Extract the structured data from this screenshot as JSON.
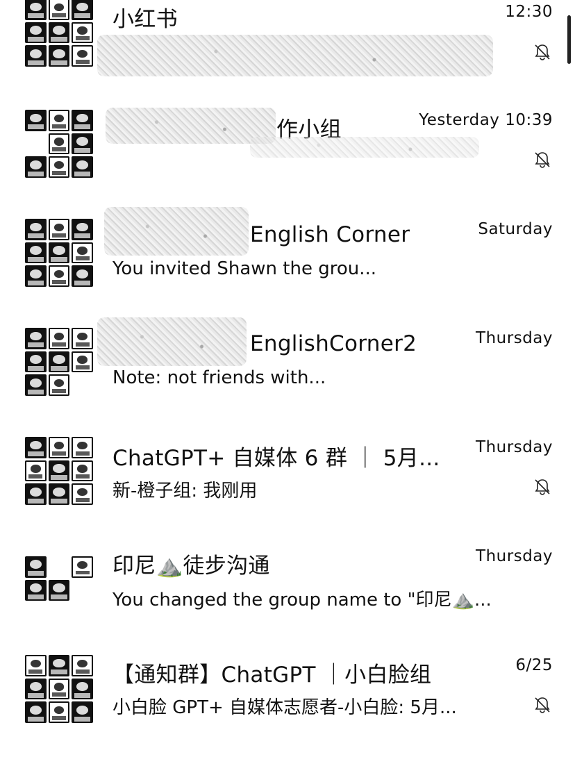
{
  "chats": [
    {
      "title": "小红书",
      "preview": "",
      "time": "12:30",
      "muted": true
    },
    {
      "title": "作小组",
      "preview": "",
      "time": "Yesterday 10:39",
      "muted": true
    },
    {
      "title": "English Corner",
      "preview": "You invited Shawn                  the grou...",
      "time": "Saturday",
      "muted": false
    },
    {
      "title": "EnglishCorner2",
      "preview": "Note:                              not friends with...",
      "time": "Thursday",
      "muted": false
    },
    {
      "title": "ChatGPT+ 自媒体 6 群 ｜ 5月...",
      "preview": "新-橙子组: 我刚用",
      "time": "Thursday",
      "muted": true
    },
    {
      "title": "印尼⛰️徒步沟通",
      "preview": "You changed the group name to \"印尼⛰️...",
      "time": "Thursday",
      "muted": false
    },
    {
      "title": "【通知群】ChatGPT ｜小白脸组",
      "preview": "小白脸 GPT+ 自媒体志愿者-小白脸: 5月...",
      "time": "6/25",
      "muted": true
    }
  ],
  "icons": {
    "mute": "bell-slash-icon",
    "avatar": "group-avatar-icon"
  }
}
